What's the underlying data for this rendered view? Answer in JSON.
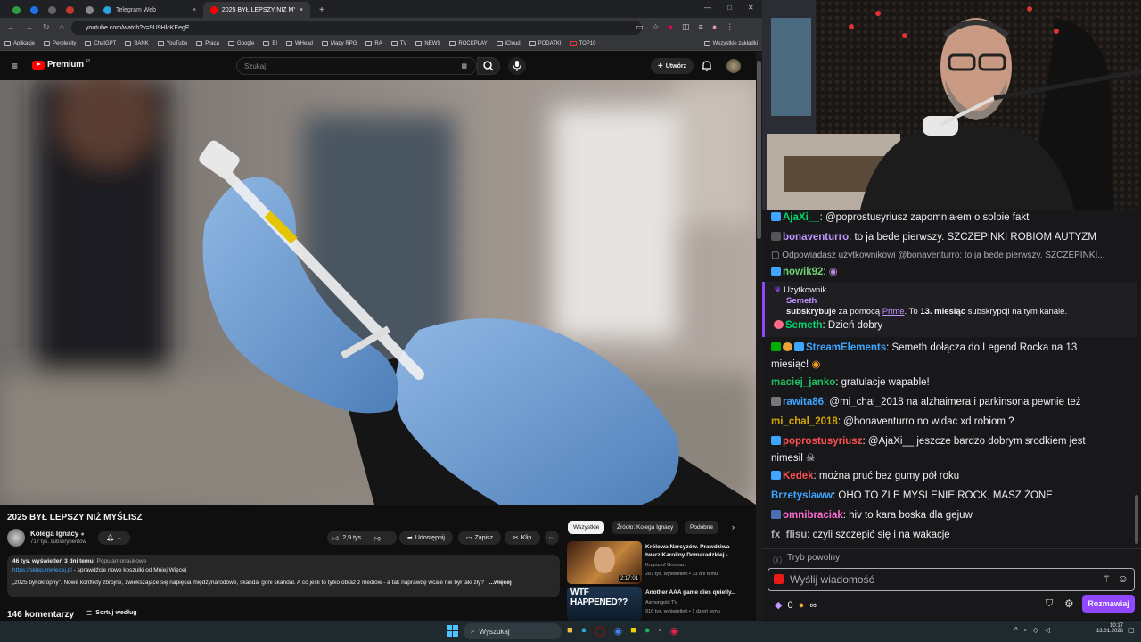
{
  "browser": {
    "tabs": [
      {
        "label": ""
      },
      {
        "label": "Telegram Web"
      },
      {
        "label": "2025 BYŁ LEPSZY NIŻ MYŚLISZ"
      }
    ],
    "new_tab": "+",
    "url": "youtube.com/watch?v=9U9HlcKEegE",
    "bookmarks": [
      "Aplikacje",
      "Perplexity",
      "ChatGPT",
      "BANK",
      "YouTube",
      "Praca",
      "Google",
      "EI",
      "WHead",
      "Mapy RPG",
      "RA",
      "TV",
      "NEWS",
      "ROCKPLAY",
      "iCloud",
      "PODATKI",
      "TOP10"
    ],
    "all_bookmarks": "Wszystkie zakładki"
  },
  "youtube": {
    "logo": "Premium",
    "logo_sup": "PL",
    "search_placeholder": "Szukaj",
    "create_label": "Utwórz",
    "video_title": "2025 BYŁ LEPSZY NIŻ MYŚLISZ",
    "channel_name": "Kolega Ignacy",
    "subscribers": "717 tys. subskrybentów",
    "likes": "2,9 tys.",
    "share": "Udostępnij",
    "save": "Zapisz",
    "clip": "Klip",
    "desc_stats": "46 tys. wyświetleń  3 dni temu",
    "desc_tag": "Popularnonaukowe",
    "desc_link": "https://sklep.mwiecej.pl",
    "desc_link_text": " - sprawdźcie nowe koszulki od Mniej Więcej",
    "desc_text": "„2025 był okropny”. Nowe konflikty zbrojne, zwiększające się napięcia międzynarodowe, skandal goni skandal. A co jeśli to tylko obraz z mediów - a tak naprawdę wcale nie był taki zły?",
    "desc_more": "...więcej",
    "comments": "146 komentarzy",
    "sort": "Sortuj według",
    "chips": [
      "Wszystkie",
      "Źródło: Kolega Ignacy",
      "Podobne"
    ],
    "recs": [
      {
        "title": "Królowa Narcyzów. Prawdziwa twarz Karoliny Domaradzkiej - ...",
        "channel": "Krzysztof Gonciarz",
        "meta": "287 tys. wyświetleń • 13 dni temu",
        "duration": "2:17:01"
      },
      {
        "title": "Another AAA game dies quietly...",
        "channel": "Asmongold TV",
        "meta": "916 tys. wyświetleń • 1 dzień temu",
        "thumb_text": "WTF HAPPENED??"
      }
    ]
  },
  "chat": {
    "messages": [
      {
        "user": "AjaXi__",
        "color": "#00d86e",
        "text": ": @poprostusyriusz zapomniałem o solpie fakt"
      },
      {
        "user": "bonaventurro",
        "color": "#bf94ff",
        "text": ": to ja bede pierwszy. SZCZEPINKI ROBIOM AUTYZM"
      },
      {
        "reply": "Odpowiadasz użytkownikowi @bonaventurro: to ja bede pierwszy. SZCZEPINKI..."
      },
      {
        "user": "nowik92",
        "color": "#6fd16f",
        "text": ":"
      },
      {
        "user": "Semeth",
        "color": "#00d86e",
        "text": ": Dzień dobry"
      },
      {
        "user": "StreamElements",
        "color": "#3ea6ff",
        "text": ": Semeth dołącza do Legend Rocka na 13"
      },
      {
        "cont": "miesiąc!"
      },
      {
        "user": "maciej_janko",
        "color": "#1fbf5f",
        "text": ": gratulacje wapable!"
      },
      {
        "user": "rawita86",
        "color": "#3ea6ff",
        "text": ": @mi_chal_2018 na alzhaimera i parkinsona pewnie też"
      },
      {
        "user": "mi_chal_2018",
        "color": "#d6a800",
        "text": ": @bonaventurro no widac xd robiom ?"
      },
      {
        "user": "poprostusyriusz",
        "color": "#ff4f4f",
        "text": ": @AjaXi__ jeszcze bardzo dobrym srodkiem jest"
      },
      {
        "cont": "nimesil"
      },
      {
        "user": "Kedek",
        "color": "#ff4f4f",
        "text": ": można pruć bez gumy pół roku"
      },
      {
        "user": "Brzetyslaww",
        "color": "#3ea6ff",
        "text": ": OHO TO ZLE MYSLENIE ROCK, MASZ ŻONE"
      },
      {
        "user": "omnibraciak",
        "color": "#ff6bd5",
        "text": ": hiv to kara boska dla gejuw"
      },
      {
        "user": "fx_flisu",
        "color": "#adadb8",
        "text": ": czyli szczepić się i na wakacje"
      }
    ],
    "sub": {
      "label": "Użytkownik",
      "name": "Semeth",
      "action": "subskrybuje",
      "via": " za pomocą ",
      "prime": "Prime",
      "mid": ". To ",
      "months": "13. miesiąc",
      "tail": " subskrypcji na tym kanale."
    },
    "slow_mode": "Tryb powolny",
    "input_placeholder": "Wyślij wiadomość",
    "points": "0",
    "infinity": "∞",
    "send_button": "Rozmawiaj"
  },
  "taskbar": {
    "search": "Wyszukaj",
    "time": "10:17",
    "date": "13.01.2026"
  }
}
